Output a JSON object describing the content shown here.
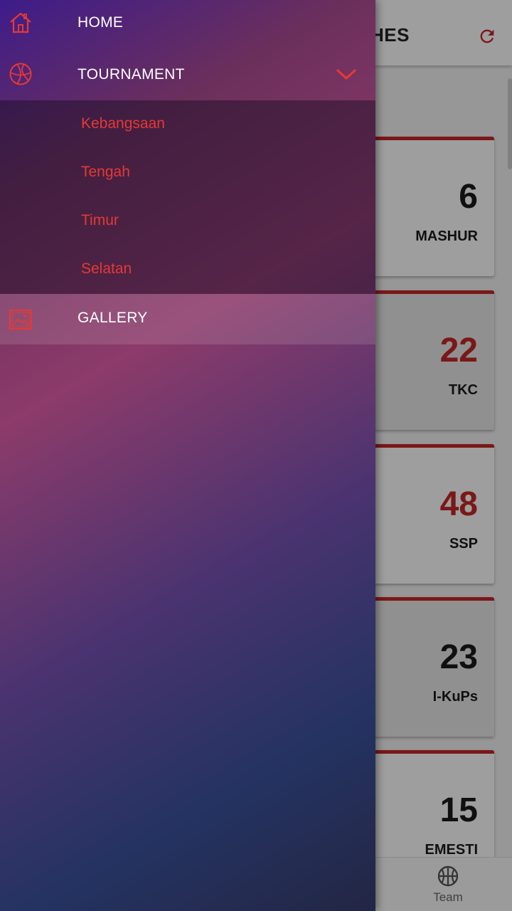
{
  "app": {
    "title": "HES",
    "cards": [
      {
        "score": "6",
        "team": "MASHUR",
        "score_color": "dark"
      },
      {
        "score": "22",
        "team": "TKC",
        "score_color": "red"
      },
      {
        "score": "48",
        "team": "SSP",
        "score_color": "red"
      },
      {
        "score": "23",
        "team": "I-KuPs",
        "score_color": "dark"
      },
      {
        "score": "15",
        "team": "EMESTI",
        "score_color": "dark"
      }
    ],
    "bottom_nav": {
      "team_label": "Team"
    }
  },
  "drawer": {
    "home_label": "HOME",
    "tournament_label": "TOURNAMENT",
    "submenu": [
      "Kebangsaan",
      "Tengah",
      "Timur",
      "Selatan"
    ],
    "gallery_label": "GALLERY"
  },
  "colors": {
    "accent": "#e53935",
    "card_border": "#c62828"
  },
  "icons": {
    "home": "home-icon",
    "tournament": "basketball-icon",
    "gallery": "image-icon",
    "refresh": "refresh-icon",
    "team": "basketball-icon"
  }
}
